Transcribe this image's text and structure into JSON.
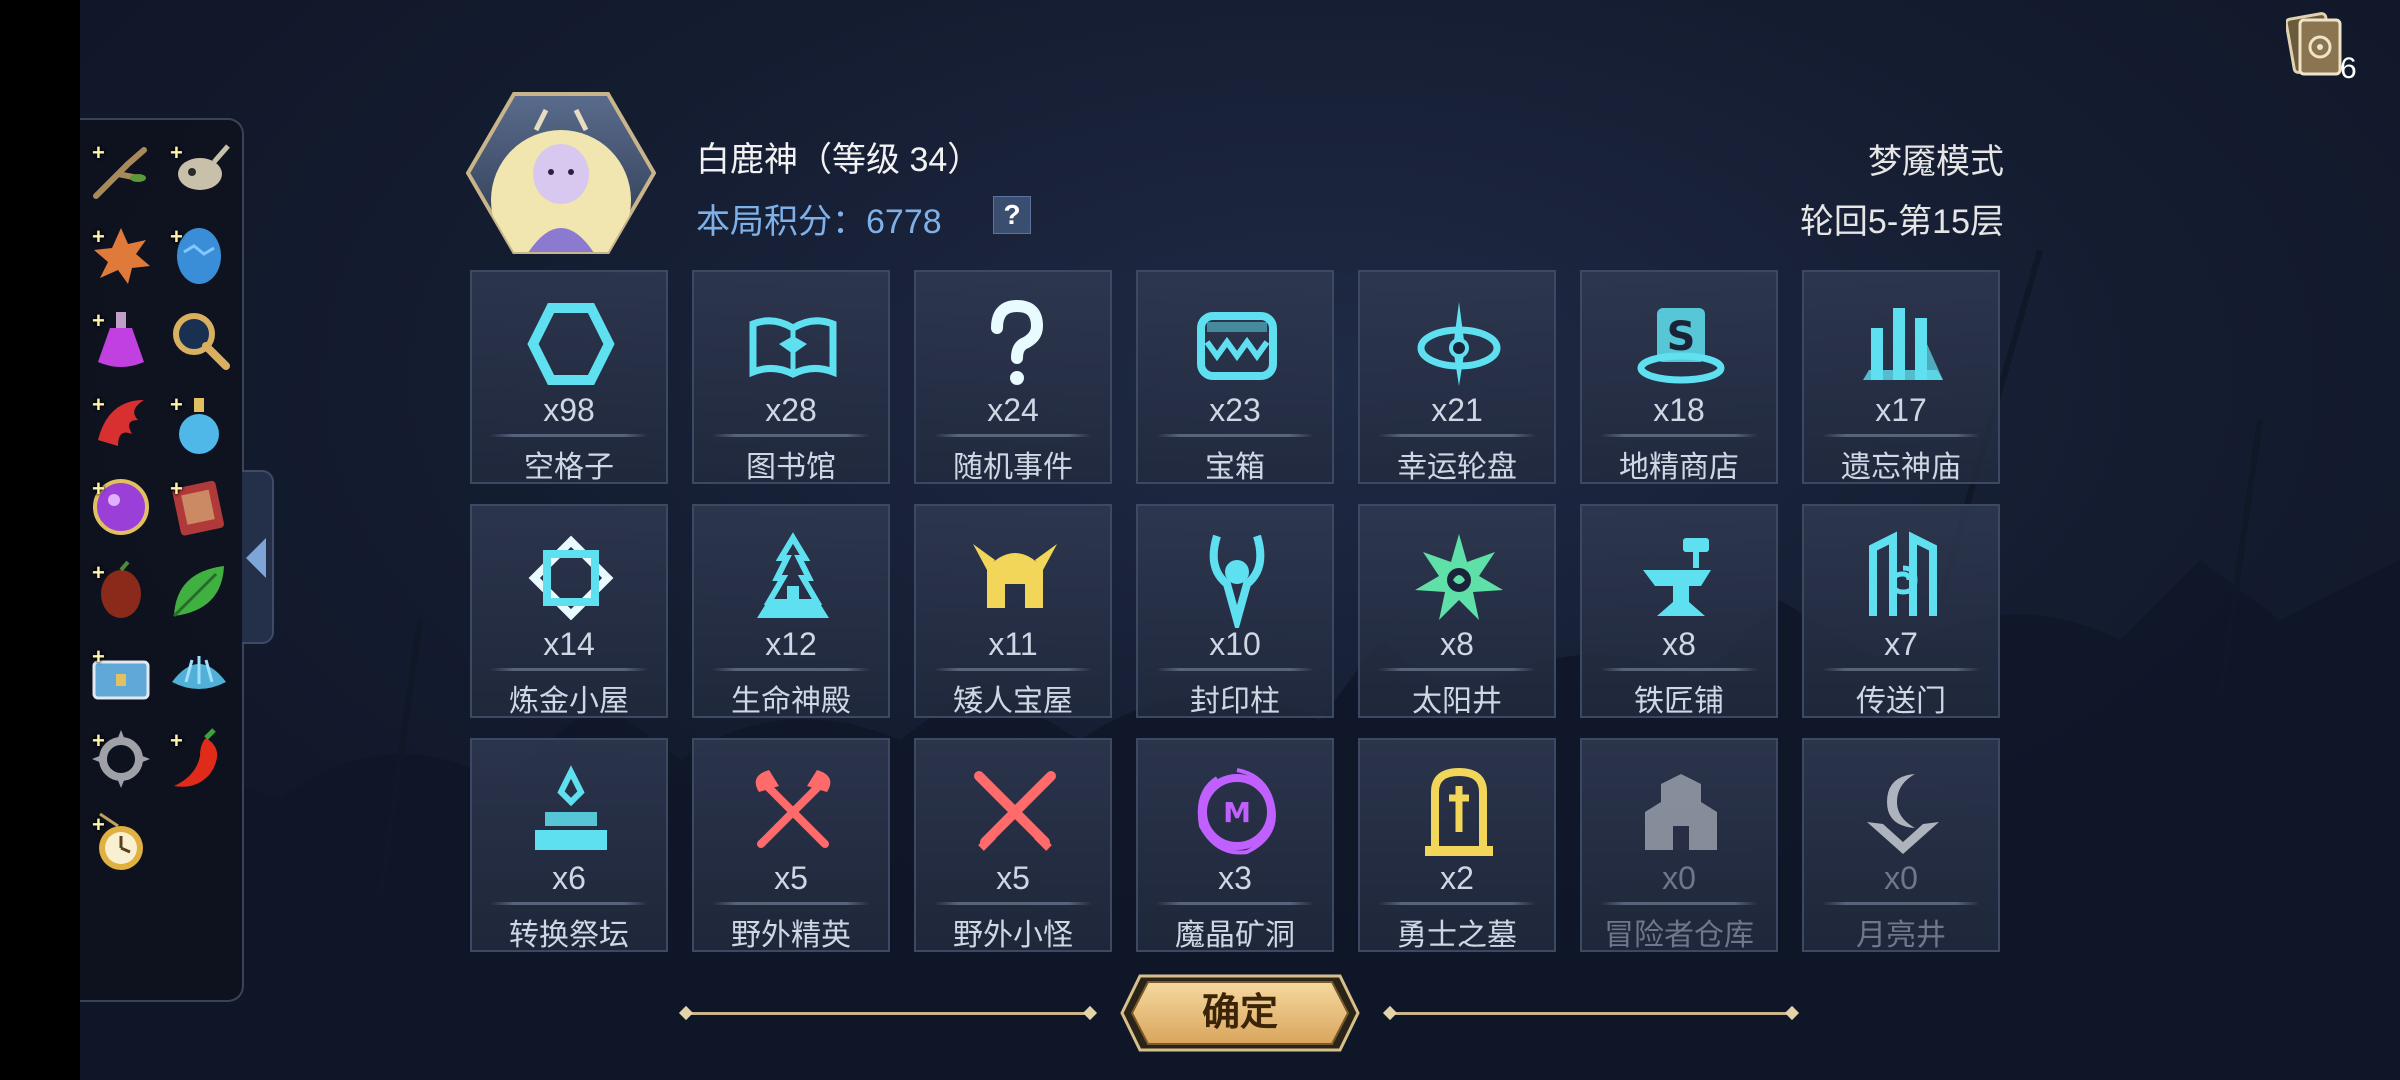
{
  "header": {
    "hero_name": "白鹿神（等级 34）",
    "score_label": "本局积分：",
    "score_value": "6778",
    "help_label": "?",
    "mode_name": "梦魇模式",
    "floor_info": "轮回5-第15层"
  },
  "deck": {
    "count": "6",
    "icon": "card-deck-icon"
  },
  "sidebar": {
    "plus_symbol": "+",
    "items": [
      {
        "icon": "branch-icon",
        "plus": true
      },
      {
        "icon": "animal-skull-icon",
        "plus": true
      },
      {
        "icon": "spiky-shell-icon",
        "plus": true
      },
      {
        "icon": "blue-egg-icon",
        "plus": true
      },
      {
        "icon": "purple-potion-icon",
        "plus": true
      },
      {
        "icon": "magnifier-icon",
        "plus": false
      },
      {
        "icon": "red-claw-icon",
        "plus": true
      },
      {
        "icon": "blue-potion-icon",
        "plus": true
      },
      {
        "icon": "purple-orb-icon",
        "plus": true
      },
      {
        "icon": "spell-book-icon",
        "plus": true
      },
      {
        "icon": "dark-seed-icon",
        "plus": true
      },
      {
        "icon": "green-leaf-icon",
        "plus": false
      },
      {
        "icon": "treasure-chest-icon",
        "plus": true
      },
      {
        "icon": "clam-shell-icon",
        "plus": false
      },
      {
        "icon": "spiked-ring-icon",
        "plus": true
      },
      {
        "icon": "chili-pepper-icon",
        "plus": true
      },
      {
        "icon": "pocket-watch-icon",
        "plus": true
      }
    ]
  },
  "tiles": [
    {
      "count": "x98",
      "label": "空格子",
      "icon": "hexagon-icon",
      "color": "#5fe0f0"
    },
    {
      "count": "x28",
      "label": "图书馆",
      "icon": "open-book-icon",
      "color": "#5fe0f0"
    },
    {
      "count": "x24",
      "label": "随机事件",
      "icon": "question-mark-icon",
      "color": "#e8fbff"
    },
    {
      "count": "x23",
      "label": "宝箱",
      "icon": "mimic-chest-icon",
      "color": "#5fe0f0"
    },
    {
      "count": "x21",
      "label": "幸运轮盘",
      "icon": "wheel-spinner-icon",
      "color": "#5fe0f0"
    },
    {
      "count": "x18",
      "label": "地精商店",
      "icon": "goblin-shop-icon",
      "color": "#5fe0f0"
    },
    {
      "count": "x17",
      "label": "遗忘神庙",
      "icon": "ruined-temple-icon",
      "color": "#5fe0f0"
    },
    {
      "count": "x14",
      "label": "炼金小屋",
      "icon": "alchemy-hut-icon",
      "color": "#e8fbff"
    },
    {
      "count": "x12",
      "label": "生命神殿",
      "icon": "life-shrine-icon",
      "color": "#5fe0f0"
    },
    {
      "count": "x11",
      "label": "矮人宝屋",
      "icon": "dwarf-helmet-icon",
      "color": "#f2d65a"
    },
    {
      "count": "x10",
      "label": "封印柱",
      "icon": "seal-pillar-icon",
      "color": "#5fe0f0"
    },
    {
      "count": "x8",
      "label": "太阳井",
      "icon": "sun-well-icon",
      "color": "#5fe0a8"
    },
    {
      "count": "x8",
      "label": "铁匠铺",
      "icon": "anvil-icon",
      "color": "#5fe0f0"
    },
    {
      "count": "x7",
      "label": "传送门",
      "icon": "portal-icon",
      "color": "#5fe0f0"
    },
    {
      "count": "x6",
      "label": "转换祭坛",
      "icon": "conversion-altar-icon",
      "color": "#5fe0f0"
    },
    {
      "count": "x5",
      "label": "野外精英",
      "icon": "crossed-axes-icon",
      "color": "#ff6b6b"
    },
    {
      "count": "x5",
      "label": "野外小怪",
      "icon": "crossed-swords-icon",
      "color": "#ff6b6b"
    },
    {
      "count": "x3",
      "label": "魔晶矿洞",
      "icon": "magic-crystal-mine-icon",
      "color": "#c060ff"
    },
    {
      "count": "x2",
      "label": "勇士之墓",
      "icon": "tombstone-icon",
      "color": "#f2d65a"
    },
    {
      "count": "x0",
      "label": "冒险者仓库",
      "icon": "warehouse-icon",
      "color": "#c8ccd4",
      "dim": true
    },
    {
      "count": "x0",
      "label": "月亮井",
      "icon": "moon-well-icon",
      "color": "#e8ecf2",
      "dim": true
    }
  ],
  "confirm": {
    "label": "确定"
  }
}
